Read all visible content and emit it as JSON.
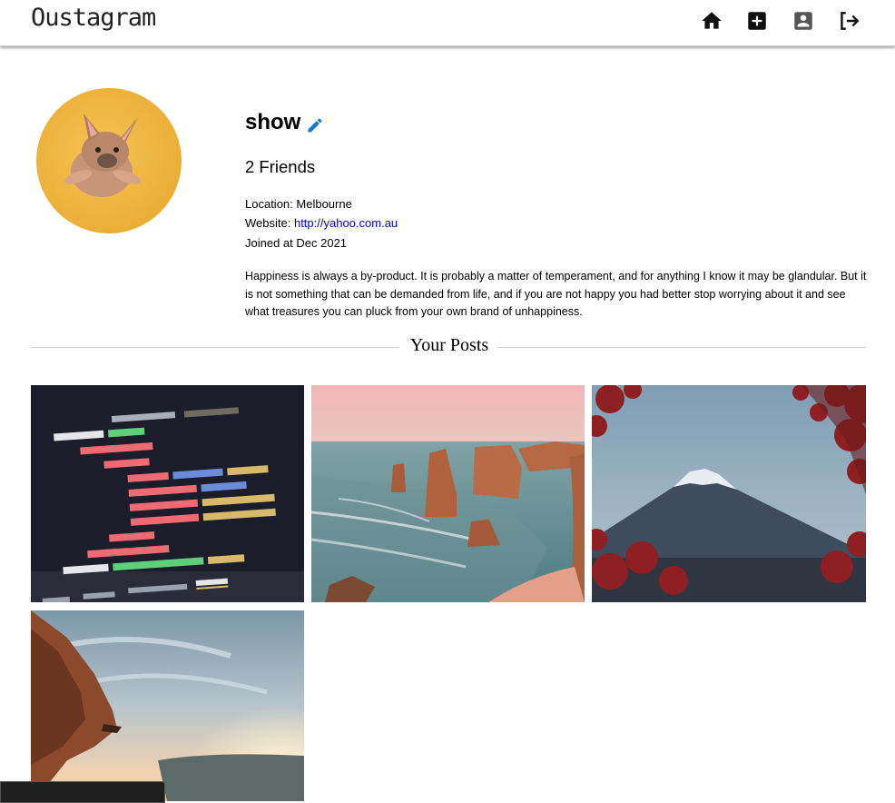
{
  "app": {
    "title": "Oustagram"
  },
  "nav": {
    "icons": [
      "home-icon",
      "add-post-icon",
      "profile-icon",
      "logout-icon"
    ]
  },
  "profile": {
    "username": "show",
    "friends": "2 Friends",
    "location_label": "Location:",
    "location": "Melbourne",
    "website_label": "Website:",
    "website": "http://yahoo.com.au",
    "joined": "Joined at Dec 2021",
    "bio": "Happiness is always a by-product. It is probably a matter of temperament, and for anything I know it may be glandular. But it is not something that can be demanded from life, and if you are not happy you had better stop worrying about it and see what treasures you can pluck from your own brand of unhappiness."
  },
  "posts_section": {
    "title": "Your Posts"
  },
  "posts": [
    {
      "id": "code-screenshot"
    },
    {
      "id": "twelve-apostles"
    },
    {
      "id": "mount-fuji"
    },
    {
      "id": "cliff-sunset"
    }
  ],
  "colors": {
    "accent": "#1976d2",
    "link": "#0000ee"
  }
}
